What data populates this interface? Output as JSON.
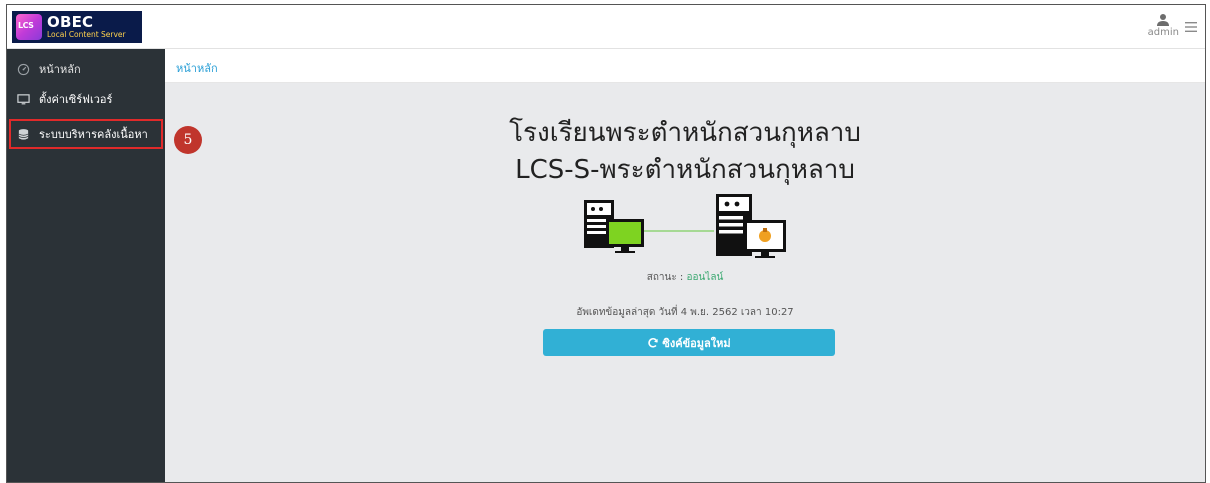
{
  "app": {
    "logo_abbrev": "LCS",
    "title": "OBEC",
    "subtitle": "Local Content Server"
  },
  "header": {
    "user_label": "admin"
  },
  "sidebar": {
    "items": [
      {
        "label": "หน้าหลัก",
        "icon": "dashboard-icon"
      },
      {
        "label": "ตั้งค่าเซิร์ฟเวอร์",
        "icon": "monitor-icon"
      },
      {
        "label": "ระบบบริหารคลังเนื้อหา",
        "icon": "database-icon"
      }
    ]
  },
  "breadcrumb": {
    "current": "หน้าหลัก"
  },
  "main": {
    "school_name": "โรงเรียนพระตำหนักสวนกุหลาบ",
    "server_name": "LCS-S-พระตำหนักสวนกุหลาบ",
    "status_label": "สถานะ : ",
    "status_value": "ออนไลน์",
    "last_update": "อัพเดทข้อมูลล่าสุด วันที่ 4 พ.ย. 2562 เวลา 10:27",
    "sync_button": "ซิงค์ข้อมูลใหม่"
  },
  "annotation": {
    "step_number": "5"
  },
  "colors": {
    "sidebar_bg": "#2b3237",
    "accent": "#31b0d5",
    "link": "#2a9fd6",
    "online": "#3aa870",
    "highlight_border": "#e02a2a",
    "step_badge": "#c0352c",
    "content_bg": "#e9eaec"
  }
}
